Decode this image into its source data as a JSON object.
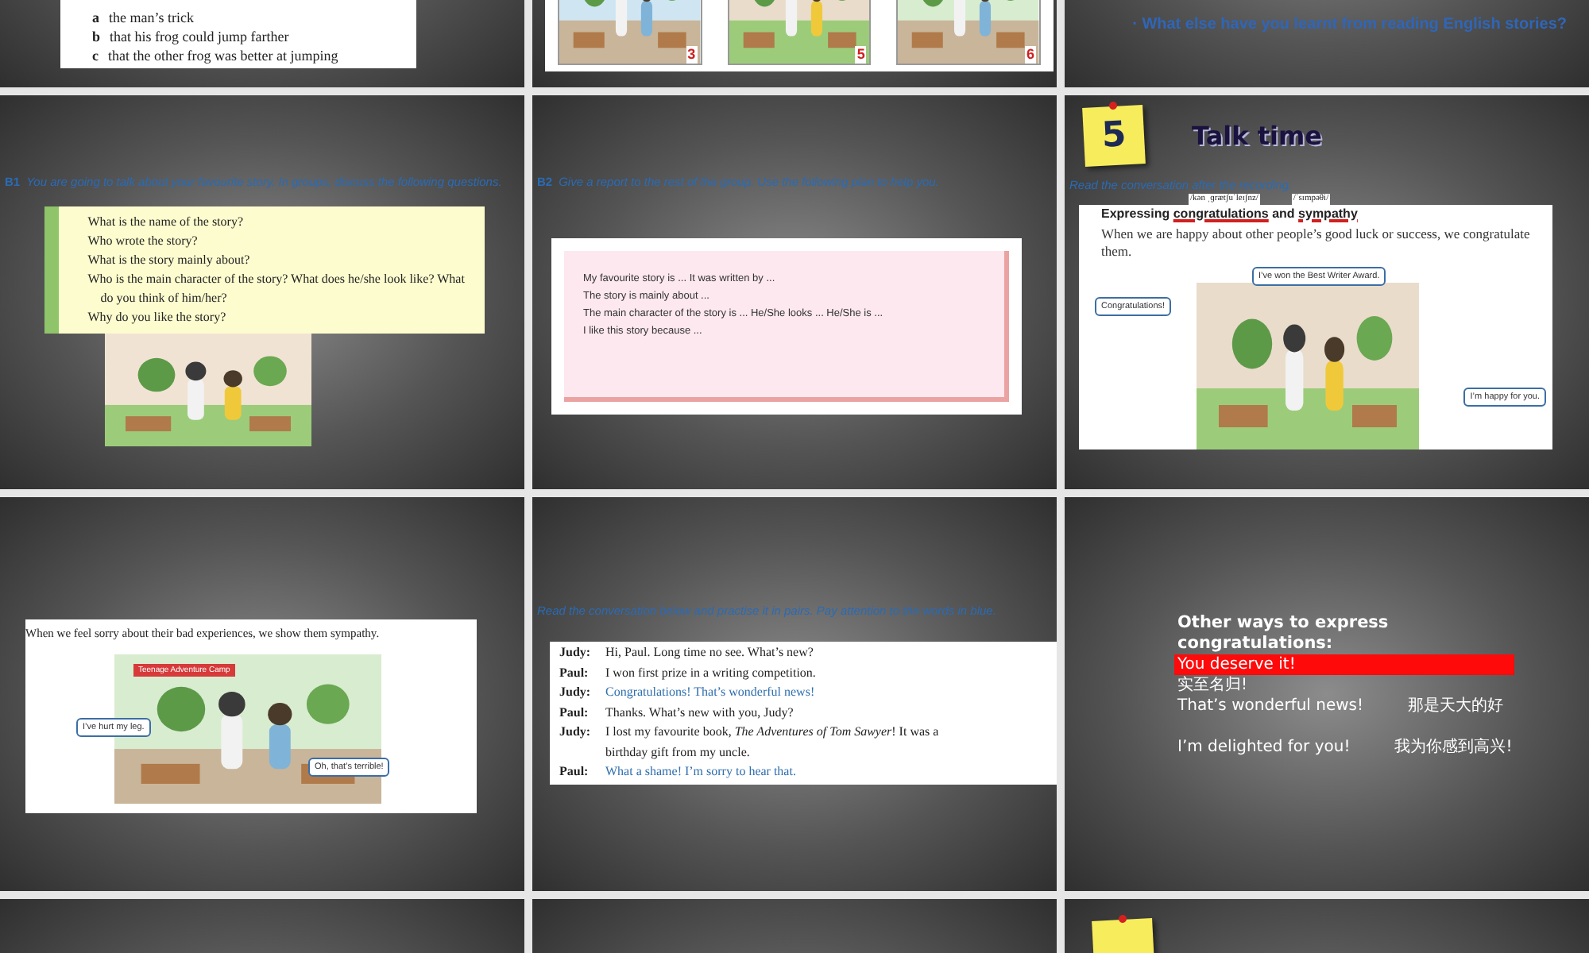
{
  "slides": [
    {
      "kind": "quiz",
      "lines": [
        {
          "label": "a",
          "text": "the man’s trick"
        },
        {
          "label": "b",
          "text": "that his frog could jump farther"
        },
        {
          "label": "c",
          "text": "that the other frog was better at jumping"
        }
      ]
    },
    {
      "kind": "pictures",
      "numbers": [
        "3",
        "5",
        "6"
      ]
    },
    {
      "kind": "question",
      "text": "· What else have you learnt from reading English stories?"
    },
    {
      "kind": "questions",
      "instruction": {
        "label": "B1",
        "text": "You are going to talk about your favourite story. In groups, discuss the following questions."
      },
      "questions": [
        "What is the name of the story?",
        "Who wrote the story?",
        "What is the story mainly about?",
        "Who is the main character of the story? What does he/she look like? What do you think of him/her?",
        "Why do you like the story?"
      ]
    },
    {
      "kind": "plan",
      "instruction": {
        "label": "B2",
        "text": "Give a report to the rest of the group. Use the following plan to help you."
      },
      "lines": [
        "My favourite story is ... It was written by ...",
        "The story is mainly about ...",
        "The main character of the story is ... He/She looks ... He/She is ...",
        "I like this story because ..."
      ]
    },
    {
      "kind": "talk",
      "number": "5",
      "title": "Talk time",
      "instruction": "Read the conversation after the recording.",
      "phonetics": [
        "/kən ˌɡrætʃuˈleɪʃnz/",
        "/ˈsɪmpəθi/"
      ],
      "heading": [
        {
          "text": "Expressing ",
          "underlined": false
        },
        {
          "text": "congratulations",
          "underlined": true
        },
        {
          "text": " and ",
          "underlined": false
        },
        {
          "text": "sympathy",
          "underlined": true
        }
      ],
      "body": "When we are happy about other people’s good luck or success, we congratulate them.",
      "bubbles": [
        "I’ve won the Best Writer Award.",
        "Congratulations!",
        "I’m happy for you."
      ]
    },
    {
      "kind": "sympathy",
      "text": "When we feel sorry about their bad experiences, we show them sympathy.",
      "banner": "Teenage Adventure Camp",
      "bubbles": [
        "I’ve hurt my leg.",
        "Oh, that’s terrible!"
      ]
    },
    {
      "kind": "dialogue",
      "instruction": "Read the conversation below and practise it in pairs. Pay attention to the words in blue.",
      "lines": [
        {
          "speaker": "Judy:",
          "text": "Hi, Paul. Long time no see. What’s new?",
          "highlighted": false
        },
        {
          "speaker": "Paul:",
          "text": "I won first prize in a writing competition.",
          "highlighted": false
        },
        {
          "speaker": "Judy:",
          "text": "Congratulations! That’s wonderful news!",
          "highlighted": true
        },
        {
          "speaker": "Paul:",
          "text": "Thanks. What’s new with you, Judy?",
          "highlighted": false
        },
        {
          "speaker": "Judy:",
          "text": "I lost my favourite book, *The Adventures of Tom Sawyer*! It was a birthday gift from my uncle.",
          "highlighted": false
        },
        {
          "speaker": "Paul:",
          "text": "What a shame! I’m sorry to hear that.",
          "highlighted": true
        }
      ]
    },
    {
      "kind": "phrases",
      "title": "Other ways to express congratulations:",
      "items": [
        {
          "en": "You deserve it!",
          "zh": "实至名归!",
          "selected": true
        },
        {
          "en": "That’s wonderful news!",
          "zh": "那是天大的好",
          "selected": false
        },
        {
          "en": "I’m delighted for you!",
          "zh": "我为你感到高兴!",
          "selected": false
        }
      ]
    },
    {
      "kind": "blank"
    },
    {
      "kind": "blank"
    },
    {
      "kind": "note"
    }
  ]
}
